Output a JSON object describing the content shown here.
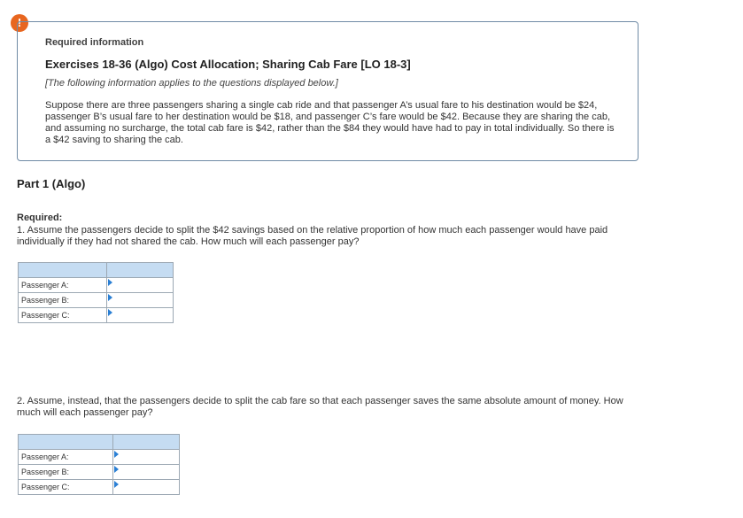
{
  "alert": {
    "icon": "exclamation-icon",
    "symbol": "!",
    "color": "#e8661f"
  },
  "info": {
    "heading": "Required information",
    "exercise_title": "Exercises 18-36 (Algo) Cost Allocation; Sharing Cab Fare [LO 18-3]",
    "note": "[The following information applies to the questions displayed below.]",
    "scenario": "Suppose there are three passengers sharing a single cab ride and that passenger A’s usual fare to his destination would be $24, passenger B’s usual fare to her destination would be $18, and passenger C’s fare would be $42. Because they are sharing the cab, and assuming no surcharge, the total cab fare is $42, rather than the $84 they would have had to pay in total individually. So there is a $42 saving to sharing the cab."
  },
  "part": {
    "title": "Part 1 (Algo)"
  },
  "required": {
    "label": "Required:",
    "question1": "1. Assume the passengers decide to split the $42 savings based on the relative proportion of how much each passenger would have paid individually if they had not shared the cab. How much will each passenger pay?",
    "question2": "2. Assume, instead, that the passengers decide to split the cab fare so that each passenger saves the same absolute amount of money. How much will each passenger pay?"
  },
  "table1": {
    "header": [
      "",
      ""
    ],
    "rows": [
      {
        "label": "Passenger A:",
        "value": ""
      },
      {
        "label": "Passenger B:",
        "value": ""
      },
      {
        "label": "Passenger C:",
        "value": ""
      }
    ]
  },
  "table2": {
    "header": [
      "",
      ""
    ],
    "rows": [
      {
        "label": "Passenger A:",
        "value": ""
      },
      {
        "label": "Passenger B:",
        "value": ""
      },
      {
        "label": "Passenger C:",
        "value": ""
      }
    ]
  },
  "colors": {
    "header_fill": "#c5dcf2",
    "box_border": "#6f8ba5",
    "cell_marker": "#2a7fd4"
  }
}
